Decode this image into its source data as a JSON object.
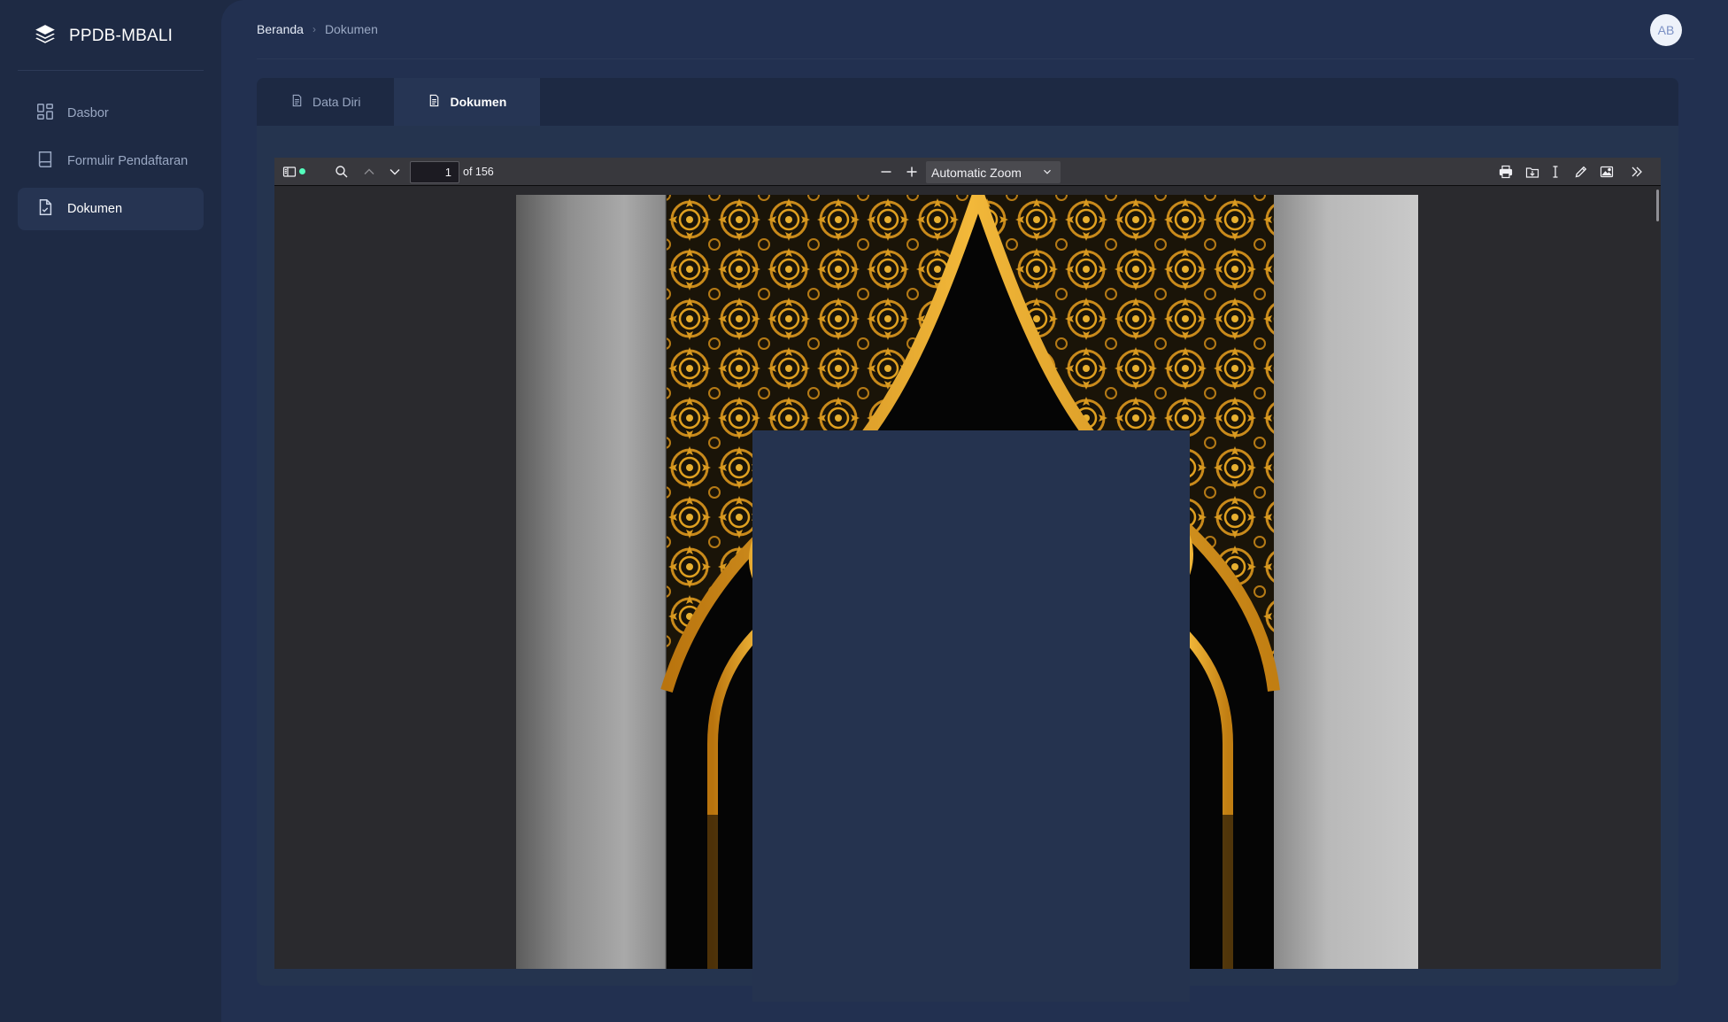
{
  "app": {
    "brand": "PPDB-MBALI"
  },
  "sidebar": {
    "items": [
      {
        "label": "Dasbor",
        "icon": "dashboard-icon",
        "active": false
      },
      {
        "label": "Formulir Pendaftaran",
        "icon": "book-icon",
        "active": false
      },
      {
        "label": "Dokumen",
        "icon": "document-check-icon",
        "active": true
      }
    ]
  },
  "header": {
    "breadcrumb": {
      "home": "Beranda",
      "current": "Dokumen"
    },
    "avatar_initials": "AB"
  },
  "tabs": [
    {
      "label": "Data Diri",
      "active": false
    },
    {
      "label": "Dokumen",
      "active": true
    }
  ],
  "pdf_viewer": {
    "current_page": "1",
    "page_count_label": "of 156",
    "zoom": "Automatic Zoom",
    "zoom_options": [
      "Automatic Zoom"
    ]
  },
  "colors": {
    "sidebar_bg": "#1e2a44",
    "main_bg": "#223050",
    "card_bg": "#25344f",
    "viewer_toolbar": "#38383d",
    "ornament_gold": "#e0a020"
  }
}
